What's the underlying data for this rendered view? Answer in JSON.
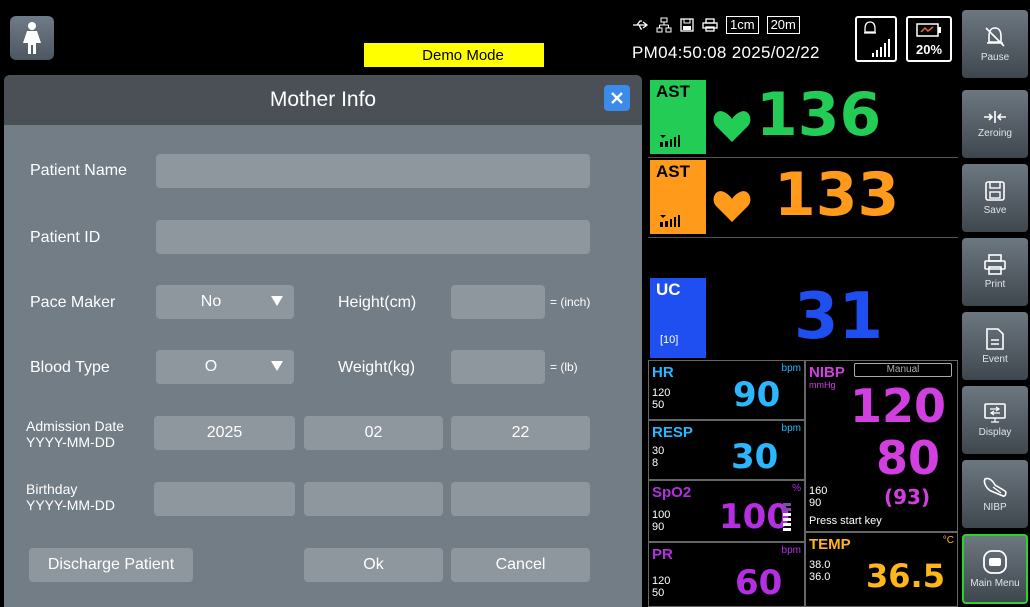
{
  "topbar": {
    "demo_mode": "Demo Mode",
    "scale_label": "1cm",
    "time_label": "20m",
    "clock": "PM04:50:08 2025/02/22",
    "battery_pct": "20%"
  },
  "dialog": {
    "title": "Mother Info",
    "fields": {
      "patient_name_label": "Patient Name",
      "patient_name_value": "",
      "patient_id_label": "Patient ID",
      "patient_id_value": "",
      "pace_maker_label": "Pace Maker",
      "pace_maker_value": "No",
      "height_label": "Height(cm)",
      "height_value": "",
      "height_unit": "= (inch)",
      "blood_type_label": "Blood Type",
      "blood_type_value": "O",
      "weight_label": "Weight(kg)",
      "weight_value": "",
      "weight_unit": "= (lb)",
      "admission_label_1": "Admission Date",
      "admission_label_2": "YYYY-MM-DD",
      "admission_year": "2025",
      "admission_month": "02",
      "admission_day": "22",
      "birthday_label_1": "Birthday",
      "birthday_label_2": "YYYY-MM-DD",
      "birthday_year": "",
      "birthday_month": "",
      "birthday_day": ""
    },
    "buttons": {
      "discharge": "Discharge Patient",
      "ok": "Ok",
      "cancel": "Cancel"
    }
  },
  "monitor": {
    "fhr1": {
      "tag": "AST",
      "value": "136",
      "color": "#22cc55"
    },
    "fhr2": {
      "tag": "AST",
      "value": "133",
      "color": "#ff9a1a"
    },
    "uc": {
      "tag": "UC",
      "sub": "[10]",
      "value": "31",
      "color": "#1f4ff0"
    },
    "hr": {
      "name": "HR",
      "unit": "bpm",
      "hi": "120",
      "lo": "50",
      "value": "90"
    },
    "resp": {
      "name": "RESP",
      "unit": "bpm",
      "hi": "30",
      "lo": "8",
      "value": "30"
    },
    "spo2": {
      "name": "SpO2",
      "unit": "%",
      "hi": "100",
      "lo": "90",
      "value": "100"
    },
    "pr": {
      "name": "PR",
      "unit": "bpm",
      "hi": "120",
      "lo": "50",
      "value": "60"
    },
    "nibp": {
      "name": "NIBP",
      "mode": "Manual",
      "unit": "mmHg",
      "sys": "120",
      "dia": "80",
      "mean": "(93)",
      "hi": "160",
      "lo": "90",
      "hint": "Press start key"
    },
    "temp": {
      "name": "TEMP",
      "unit": "°C",
      "hi": "38.0",
      "lo": "36.0",
      "value": "36.5"
    }
  },
  "sidebar": {
    "pause": "Pause",
    "zeroing": "Zeroing",
    "save": "Save",
    "print": "Print",
    "event": "Event",
    "display": "Display",
    "nibp": "NIBP",
    "main_menu": "Main Menu"
  }
}
